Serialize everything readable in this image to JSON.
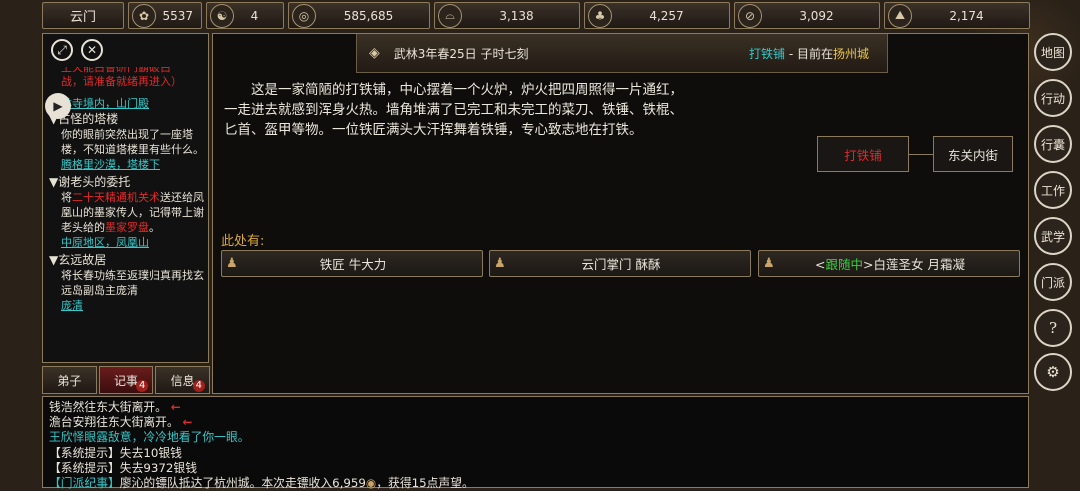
{
  "topbar": {
    "sect": "云门",
    "resources": [
      {
        "icon": "phoenix-icon",
        "glyph": "✿",
        "value": "5537"
      },
      {
        "icon": "yinyang-icon",
        "glyph": "☯",
        "value": "4"
      },
      {
        "icon": "coin-icon",
        "glyph": "◎",
        "value": "585,685"
      },
      {
        "icon": "food-icon",
        "glyph": "⌓",
        "value": "3,138"
      },
      {
        "icon": "herb-icon",
        "glyph": "♣",
        "value": "4,257"
      },
      {
        "icon": "wood-icon",
        "glyph": "⊘",
        "value": "3,092"
      },
      {
        "icon": "ore-icon",
        "glyph": "⛰",
        "value": "2,174"
      }
    ]
  },
  "sidebar": {
    "quests": [
      {
        "title": "古怪的塔楼",
        "desc": "你的眼前突然出现了一座塔楼，不知道塔楼里有些什么。",
        "loc": "腾格里沙漠，塔楼下"
      },
      {
        "title": "谢老头的委托",
        "desc_pre": "将",
        "desc_red1": "二十天精通机关术",
        "desc_mid": "送还给凤凰山的墨家传人，记得带上谢老头给的",
        "desc_red2": "墨家罗盘",
        "desc_end": "。",
        "loc": "中原地区，凤凰山"
      },
      {
        "title": "玄远故居",
        "desc": "将长春功练至返璞归真再找玄远岛副岛主庞清",
        "loc": "庞清"
      }
    ],
    "partial": {
      "red_line1": "上天能白鲁研门霸破白",
      "red_line2": "战，请准备就绪再进入）",
      "loc": "林寺境内，山门殿"
    }
  },
  "tabs": [
    {
      "label": "弟子",
      "badge": ""
    },
    {
      "label": "记事",
      "badge": "4"
    },
    {
      "label": "信息",
      "badge": "4"
    }
  ],
  "header": {
    "date": "武林3年春25日 子时七刻",
    "place_name": "打铁铺",
    "sep": " - 目前在",
    "city": "扬州城"
  },
  "scene": {
    "text": "这是一家简陋的打铁铺，中心摆着一个火炉，炉火把四周照得一片通红，一走进去就感到浑身火热。墙角堆满了已完工和未完工的菜刀、铁锤、铁棍、匕首、盔甲等物。一位铁匠满头大汗挥舞着铁锤，专心致志地在打铁。"
  },
  "exits": {
    "current": "打铁铺",
    "east": "东关内街"
  },
  "here": {
    "label": "此处有:",
    "npcs": [
      {
        "name": "铁匠 牛大力",
        "tag": ""
      },
      {
        "name": "云门掌门 酥酥",
        "tag": ""
      },
      {
        "name": "白莲圣女 月霜凝",
        "tag_open": "<",
        "tag": "跟随中",
        "tag_close": ">"
      }
    ]
  },
  "log": [
    {
      "text": "钱浩然往东大街离开。",
      "arrow": "←",
      "color": "#ece7dc"
    },
    {
      "text": "澹台安翔往东大街离开。",
      "arrow": "←",
      "color": "#ece7dc"
    },
    {
      "text": "王欣怿眼露敌意，冷冷地看了你一眼。",
      "arrow": "",
      "color": "#35c7c9"
    },
    {
      "text": "【系统提示】失去10银钱",
      "arrow": "",
      "color": "#ece7dc"
    },
    {
      "text": "【系统提示】失去9372银钱",
      "arrow": "",
      "color": "#ece7dc"
    }
  ],
  "log_last": {
    "tag": "【门派纪事】",
    "text": "廖沁的镖队抵达了杭州城。本次走镖收入6,959",
    "text2": "，获得15点声望。"
  },
  "right_menu": [
    {
      "label": "地图",
      "name": "map-button"
    },
    {
      "label": "行动",
      "name": "action-button"
    },
    {
      "label": "行囊",
      "name": "bag-button"
    },
    {
      "label": "工作",
      "name": "work-button"
    },
    {
      "label": "武学",
      "name": "martial-button"
    },
    {
      "label": "门派",
      "name": "sect-button"
    },
    {
      "label": "?",
      "name": "help-button"
    },
    {
      "label": "⚙",
      "name": "settings-button"
    }
  ],
  "colors": {
    "accent_cyan": "#35c7c9",
    "accent_gold": "#e8c44a",
    "alert_red": "#e02a2a",
    "follow_green": "#3ccc44",
    "border": "#8b7a5c"
  }
}
